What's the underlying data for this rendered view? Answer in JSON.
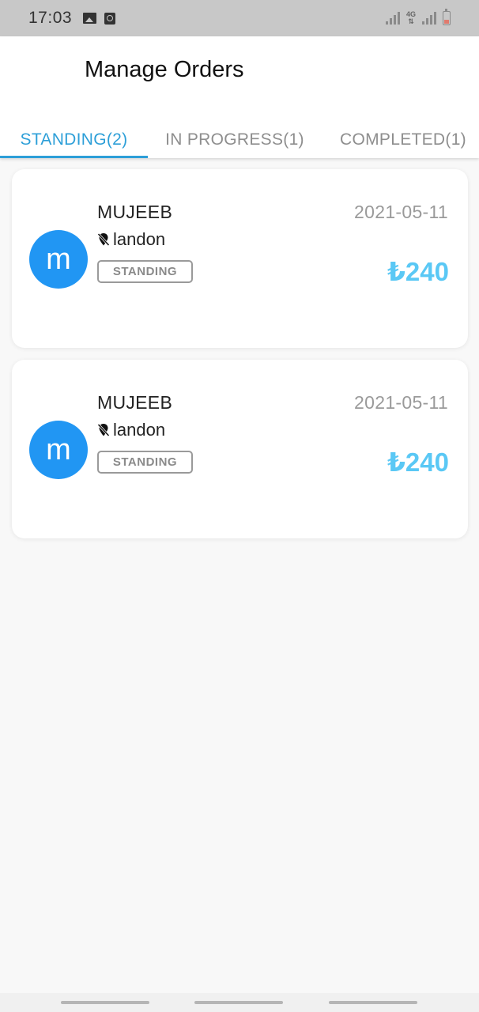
{
  "status_bar": {
    "time": "17:03",
    "icons": [
      "image-icon",
      "clock-icon",
      "signal-icon",
      "4g-icon",
      "signal-icon",
      "battery-icon"
    ],
    "network": "4G"
  },
  "header": {
    "title": "Manage Orders"
  },
  "tabs": [
    {
      "label": "STANDING(2)",
      "active": true
    },
    {
      "label": "IN PROGRESS(1)",
      "active": false
    },
    {
      "label": "COMPLETED(1)",
      "active": false
    }
  ],
  "orders": [
    {
      "avatar_letter": "m",
      "customer": "MUJEEB",
      "date": "2021-05-11",
      "location": "landon",
      "status": "STANDING",
      "amount": "₺240"
    },
    {
      "avatar_letter": "m",
      "customer": "MUJEEB",
      "date": "2021-05-11",
      "location": "landon",
      "status": "STANDING",
      "amount": "₺240"
    }
  ],
  "colors": {
    "accent": "#2d9fd8",
    "avatar": "#2196f3",
    "amount": "#5ac8f5",
    "status_bar": "#c8c8c8"
  }
}
